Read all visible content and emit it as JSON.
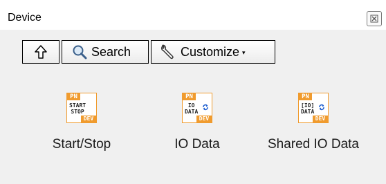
{
  "window": {
    "title": "Device",
    "close_icon": "close-icon"
  },
  "toolbar": {
    "up_icon": "up-arrow-icon",
    "search_label": "Search",
    "search_icon": "magnifier-icon",
    "customize_label": "Customize",
    "customize_icon": "wrench-icon",
    "customize_caret": "▾"
  },
  "items": [
    {
      "label": "Start/Stop",
      "badge_top": "PN",
      "badge_bottom": "DEV",
      "icon_text": "START\nSTOP",
      "icon": "start-stop-vi-icon"
    },
    {
      "label": "IO Data",
      "badge_top": "PN",
      "badge_bottom": "DEV",
      "icon_text": "IO\nDATA",
      "icon": "io-data-vi-icon"
    },
    {
      "label": "Shared IO Data",
      "badge_top": "PN",
      "badge_bottom": "DEV",
      "icon_text": "[IO]\nDATA",
      "icon": "shared-io-data-vi-icon"
    }
  ],
  "colors": {
    "accent_orange": "#f09b2e",
    "refresh_blue": "#1f5fd0"
  }
}
